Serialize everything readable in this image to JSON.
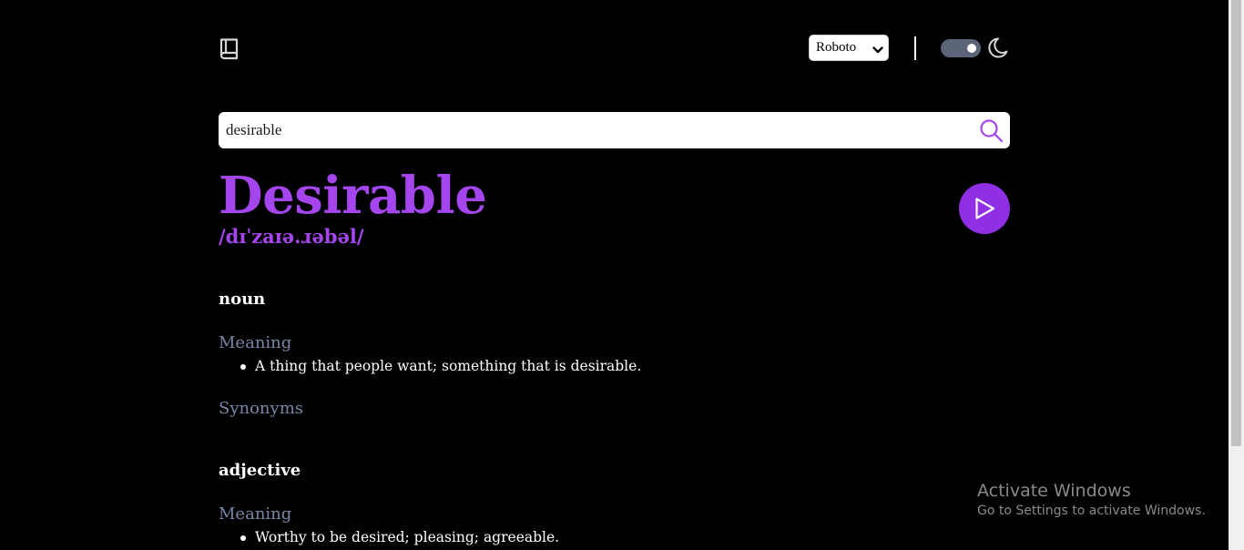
{
  "header": {
    "logo_icon": "book-icon",
    "font_select": {
      "selected": "Roboto",
      "icon": "chevron-down-icon"
    },
    "theme_toggle_icon": "moon-icon",
    "theme_toggle_on": true
  },
  "search": {
    "value": "desirable",
    "icon": "search-icon",
    "icon_color": "#a445ed"
  },
  "entry": {
    "word": "Desirable",
    "phonetic": "/dɪˈzaɪə.ɹəbəl/",
    "play_icon": "play-icon",
    "accent_color": "#a445ed",
    "meanings": [
      {
        "part_of_speech": "noun",
        "meaning_label": "Meaning",
        "definitions": [
          "A thing that people want; something that is desirable."
        ],
        "synonyms_label": "Synonyms"
      },
      {
        "part_of_speech": "adjective",
        "meaning_label": "Meaning",
        "definitions": [
          "Worthy to be desired; pleasing; agreeable."
        ]
      }
    ]
  },
  "watermark": {
    "title": "Activate Windows",
    "subtitle": "Go to Settings to activate Windows."
  }
}
